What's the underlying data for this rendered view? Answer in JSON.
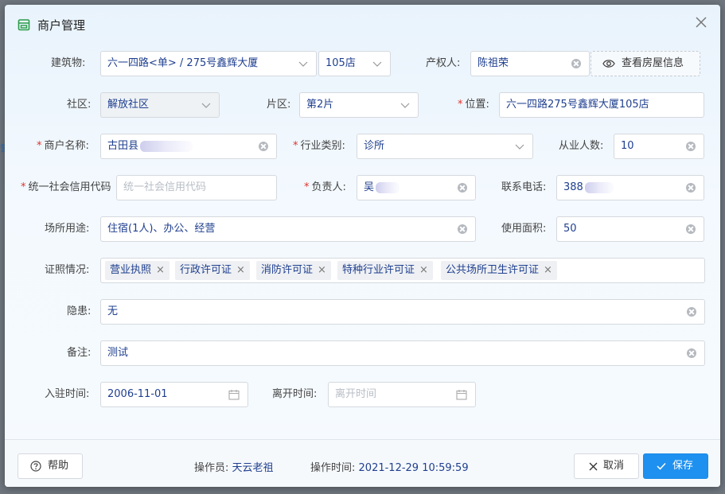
{
  "dialog": {
    "title": "商户管理",
    "icon": "shop-icon",
    "close_icon": "close-icon"
  },
  "form": {
    "building": {
      "label": "建筑物:",
      "value": "六一四路<单> / 275号鑫辉大厦"
    },
    "shop_no": {
      "value": "105店"
    },
    "owner": {
      "label": "产权人:",
      "value": "陈祖荣"
    },
    "view_house_button": "查看房屋信息",
    "community": {
      "label": "社区:",
      "value": "解放社区"
    },
    "area": {
      "label": "片区:",
      "value": "第2片"
    },
    "location": {
      "label": "位置:",
      "value": "六一四路275号鑫辉大厦105店",
      "required": "*"
    },
    "merchant_name": {
      "label": "商户名称:",
      "value": "古田县",
      "required": "*"
    },
    "industry": {
      "label": "行业类别:",
      "value": "诊所",
      "required": "*"
    },
    "employees": {
      "label": "从业人数:",
      "value": "10"
    },
    "credit_code": {
      "label": "统一社会信用代码",
      "placeholder": "统一社会信用代码",
      "required": "*"
    },
    "manager": {
      "label": "负责人:",
      "value": "吴",
      "required": "*"
    },
    "phone": {
      "label": "联系电话:",
      "value": "388"
    },
    "usage": {
      "label": "场所用途:",
      "value": "住宿(1人)、办公、经营"
    },
    "use_area": {
      "label": "使用面积:",
      "value": "50"
    },
    "licenses": {
      "label": "证照情况:",
      "tags": [
        "营业执照",
        "行政许可证",
        "消防许可证",
        "特种行业许可证",
        "公共场所卫生许可证"
      ]
    },
    "hazard": {
      "label": "隐患:",
      "value": "无"
    },
    "remark": {
      "label": "备注:",
      "value": "测试"
    },
    "move_in": {
      "label": "入驻时间:",
      "value": "2006-11-01"
    },
    "move_out": {
      "label": "离开时间:",
      "placeholder": "离开时间"
    }
  },
  "footer": {
    "help_button": "帮助",
    "operator_label": "操作员:",
    "operator_value": "天云老祖",
    "optime_label": "操作时间:",
    "optime_value": "2021-12-29 10:59:59",
    "cancel_button": "取消",
    "save_button": "保存"
  },
  "colors": {
    "accent": "#1e90ef",
    "required": "#e0322b",
    "value_text": "#1f3f8f"
  }
}
